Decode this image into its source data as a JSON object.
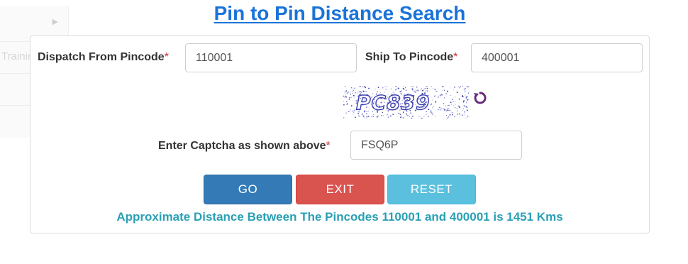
{
  "page": {
    "title": "Pin to Pin Distance Search"
  },
  "sidebar": {
    "ghost_text": "Trainin"
  },
  "form": {
    "dispatch_label": "Dispatch From Pincode",
    "dispatch_value": "110001",
    "ship_label": "Ship To Pincode",
    "ship_value": "400001",
    "captcha_label": "Enter Captcha as shown above",
    "captcha_value": "FSQ6P",
    "captcha_image_text": "PC839",
    "required_mark": "*"
  },
  "buttons": {
    "go": "GO",
    "exit": "EXIT",
    "reset": "RESET"
  },
  "result": {
    "text": "Approximate Distance Between The Pincodes 110001 and 400001 is 1451 Kms"
  },
  "colors": {
    "title": "#1a73d9",
    "go": "#337ab7",
    "exit": "#d9534f",
    "reset": "#5bc0de",
    "result": "#2aa0b4",
    "captcha": "#3b3fb0",
    "refresh": "#6b2d7a"
  },
  "icons": {
    "refresh": "refresh-icon",
    "chevron": "chevron-right-icon"
  }
}
